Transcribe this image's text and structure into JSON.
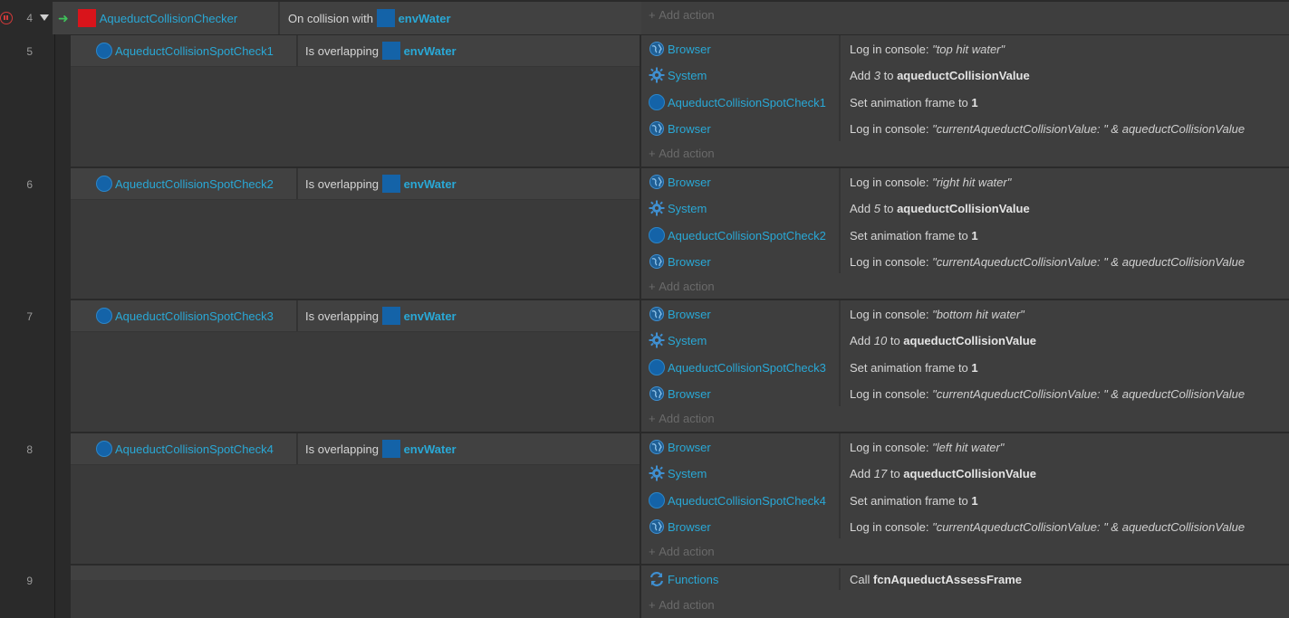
{
  "event4": {
    "row_num": "4",
    "object": "AqueductCollisionChecker",
    "condition_prefix": "On collision with",
    "condition_object": "envWater",
    "add_action": "Add action"
  },
  "events": [
    {
      "row_num": "5",
      "object": "AqueductCollisionSpotCheck1",
      "condition_prefix": "Is overlapping",
      "condition_object": "envWater",
      "actions": [
        {
          "object": "Browser",
          "pre": "Log in console: ",
          "value": "\"top hit water\"",
          "post": ""
        },
        {
          "object": "System",
          "pre": "Add ",
          "value": "3",
          "mid": " to ",
          "bold": "aqueductCollisionValue"
        },
        {
          "object": "AqueductCollisionSpotCheck1",
          "pre": "Set animation frame to ",
          "bold": "1"
        },
        {
          "object": "Browser",
          "pre": "Log in console: ",
          "value": "\"currentAqueductCollisionValue: \" & aqueductCollisionValue"
        }
      ],
      "add_action": "Add action"
    },
    {
      "row_num": "6",
      "object": "AqueductCollisionSpotCheck2",
      "condition_prefix": "Is overlapping",
      "condition_object": "envWater",
      "actions": [
        {
          "object": "Browser",
          "pre": "Log in console: ",
          "value": "\"right hit water\""
        },
        {
          "object": "System",
          "pre": "Add ",
          "value": "5",
          "mid": " to ",
          "bold": "aqueductCollisionValue"
        },
        {
          "object": "AqueductCollisionSpotCheck2",
          "pre": "Set animation frame to ",
          "bold": "1"
        },
        {
          "object": "Browser",
          "pre": "Log in console: ",
          "value": "\"currentAqueductCollisionValue: \" & aqueductCollisionValue"
        }
      ],
      "add_action": "Add action"
    },
    {
      "row_num": "7",
      "object": "AqueductCollisionSpotCheck3",
      "condition_prefix": "Is overlapping",
      "condition_object": "envWater",
      "actions": [
        {
          "object": "Browser",
          "pre": "Log in console: ",
          "value": "\"bottom hit water\""
        },
        {
          "object": "System",
          "pre": "Add ",
          "value": "10",
          "mid": " to ",
          "bold": "aqueductCollisionValue"
        },
        {
          "object": "AqueductCollisionSpotCheck3",
          "pre": "Set animation frame to ",
          "bold": "1"
        },
        {
          "object": "Browser",
          "pre": "Log in console: ",
          "value": "\"currentAqueductCollisionValue: \" & aqueductCollisionValue"
        }
      ],
      "add_action": "Add action"
    },
    {
      "row_num": "8",
      "object": "AqueductCollisionSpotCheck4",
      "condition_prefix": "Is overlapping",
      "condition_object": "envWater",
      "actions": [
        {
          "object": "Browser",
          "pre": "Log in console: ",
          "value": "\"left hit water\""
        },
        {
          "object": "System",
          "pre": "Add ",
          "value": "17",
          "mid": " to ",
          "bold": "aqueductCollisionValue"
        },
        {
          "object": "AqueductCollisionSpotCheck4",
          "pre": "Set animation frame to ",
          "bold": "1"
        },
        {
          "object": "Browser",
          "pre": "Log in console: ",
          "value": "\"currentAqueductCollisionValue: \" & aqueductCollisionValue"
        }
      ],
      "add_action": "Add action"
    }
  ],
  "event9": {
    "row_num": "9",
    "action_object": "Functions",
    "action_pre": "Call ",
    "action_bold": "fcnAqueductAssessFrame",
    "add_action": "Add action"
  },
  "icons": {
    "breakpoint": "pause-circle-icon",
    "collapse": "triangle-down-icon",
    "trigger": "green-arrow-icon",
    "browser": "globe-icon",
    "system": "gear-icon",
    "functions": "refresh-arrows-icon",
    "sprite": "blue-circle-icon"
  },
  "colors": {
    "object_link": "#29a8d6",
    "breakpoint": "#d23a3a",
    "trigger": "#3fc15a",
    "sprite_red": "#d9141b",
    "sprite_blue": "#1463a8"
  }
}
